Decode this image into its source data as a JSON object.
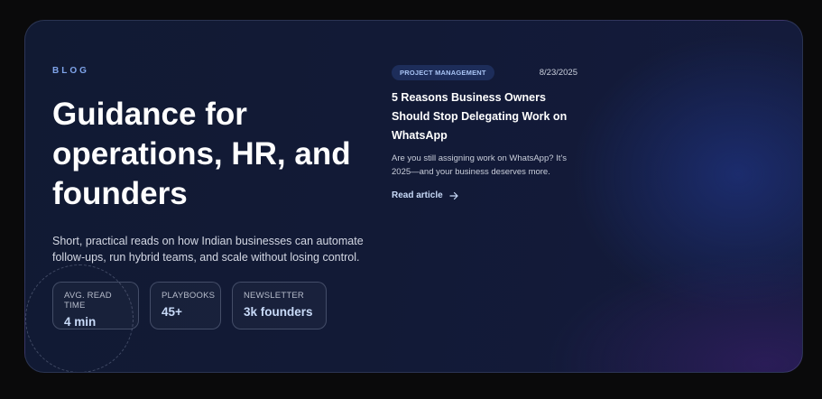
{
  "hero": {
    "eyebrow": "BLOG",
    "title": "Guidance for operations, HR, and founders",
    "lede": "Short, practical reads on how Indian businesses can automate follow-ups, run hybrid teams, and scale without losing control."
  },
  "stats": [
    {
      "label": "AVG. READ TIME",
      "value": "4 min"
    },
    {
      "label": "PLAYBOOKS",
      "value": "45+"
    },
    {
      "label": "NEWSLETTER",
      "value": "3k founders"
    }
  ],
  "article": {
    "tag": "PROJECT MANAGEMENT",
    "date": "8/23/2025",
    "title": "5 Reasons Business Owners Should Stop Delegating Work on WhatsApp",
    "excerpt": "Are you still assigning work on WhatsApp? It's 2025—and your business deserves more.",
    "cta": "Read article",
    "cta_icon": "arrow-right-icon"
  },
  "colors": {
    "accent": "#7fa4ea",
    "stat_value": "#c8daf8",
    "tag_bg": "#1d2d5a"
  }
}
